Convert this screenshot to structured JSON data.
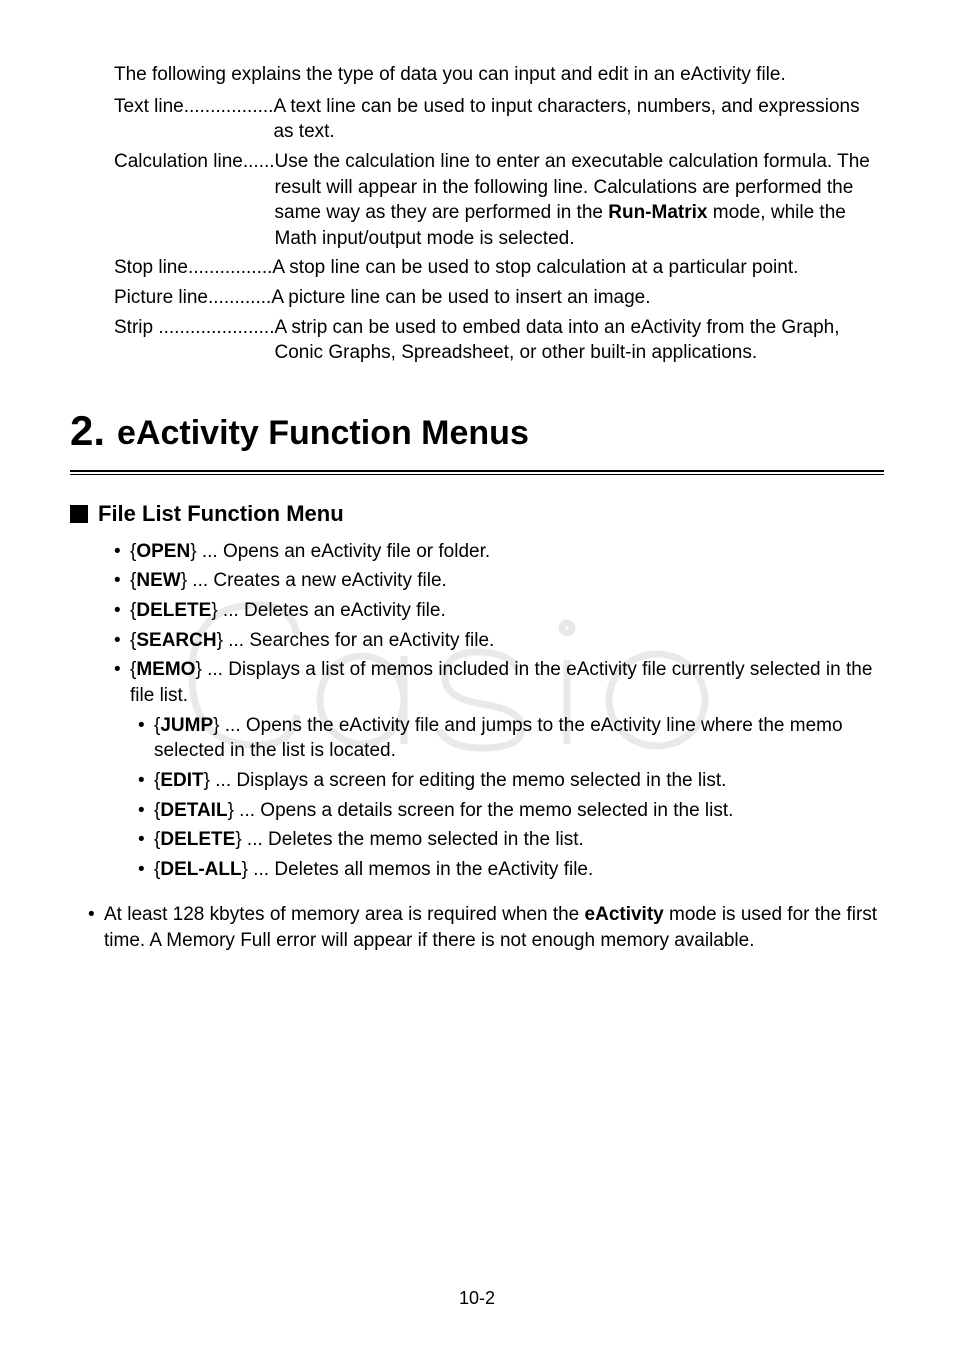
{
  "defs": {
    "intro": "The following explains the type of data you can input and edit in an eActivity file.",
    "rows": [
      {
        "term": "Text line",
        "dots": ".................",
        "desc_html": "A text line can be used to input characters, numbers, and expressions as text."
      },
      {
        "term": "Calculation line",
        "dots": "......",
        "desc_html": "Use the calculation line to enter an executable calculation formula. The result will appear in the following line. Calculations are performed the same way as they are performed in the <b>Run-Matrix</b> mode, while the Math input/output mode is selected."
      },
      {
        "term": "Stop line",
        "dots": "................",
        "desc_html": "A stop line can be used to stop calculation at a particular point."
      },
      {
        "term": "Picture line",
        "dots": "............",
        "desc_html": "A picture line can be used to insert an image."
      },
      {
        "term": "Strip",
        "dots": " ......................",
        "desc_html": "A strip can be used to embed data into an eActivity from the Graph, Conic Graphs, Spreadsheet, or other built-in applications."
      }
    ]
  },
  "section": {
    "number": "2.",
    "title": "eActivity Function Menus"
  },
  "subsection": {
    "title": "File List Function Menu"
  },
  "menu": [
    {
      "key": "OPEN",
      "text": " ... Opens an eActivity file or folder."
    },
    {
      "key": "NEW",
      "text": " ... Creates a new eActivity file."
    },
    {
      "key": "DELETE",
      "text": " ... Deletes an eActivity file."
    },
    {
      "key": "SEARCH",
      "text": " ... Searches for an eActivity file."
    },
    {
      "key": "MEMO",
      "text": " ... Displays a list of memos included in the eActivity file currently selected in the file list."
    }
  ],
  "submenu": [
    {
      "key": "JUMP",
      "text": " ... Opens the eActivity file and jumps to the eActivity line where the memo selected in the list is located."
    },
    {
      "key": "EDIT",
      "text": " ... Displays a screen for editing the memo selected in the list."
    },
    {
      "key": "DETAIL",
      "text": " ... Opens a details screen for the memo selected in the list."
    },
    {
      "key": "DELETE",
      "text": " ... Deletes the memo selected in the list."
    },
    {
      "key": "DEL-ALL",
      "text": " ... Deletes all memos in the eActivity file."
    }
  ],
  "footnote_html": "At least 128 kbytes of memory area is required when the <b>eActivity</b> mode is used for the first time. A Memory Full error will appear if there is not enough memory available.",
  "page_number": "10-2"
}
